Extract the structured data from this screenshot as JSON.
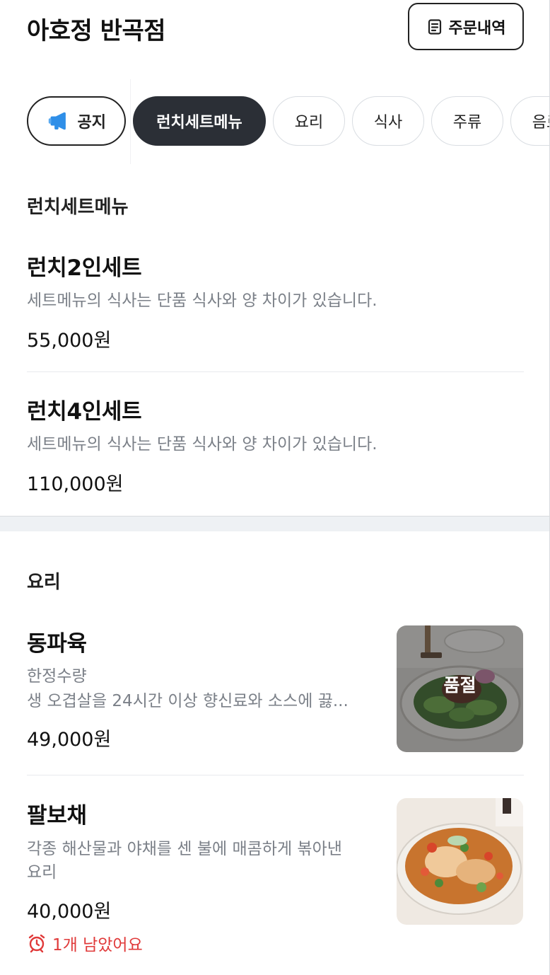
{
  "header": {
    "store_name": "아호정 반곡점",
    "orders_button": {
      "label": "주문내역",
      "icon": "receipt-icon"
    }
  },
  "tabs": [
    {
      "label": "공지",
      "icon": "megaphone-icon",
      "state": "outlined"
    },
    {
      "label": "런치세트메뉴",
      "state": "selected"
    },
    {
      "label": "요리",
      "state": "default"
    },
    {
      "label": "식사",
      "state": "default"
    },
    {
      "label": "주류",
      "state": "default"
    },
    {
      "label": "음료",
      "state": "partially-visible"
    }
  ],
  "sections": [
    {
      "title": "런치세트메뉴",
      "items": [
        {
          "name": "런치2인세트",
          "description": "세트메뉴의 식사는 단품 식사와 양 차이가 있습니다.",
          "price": "55,000원"
        },
        {
          "name": "런치4인세트",
          "description": "세트메뉴의 식사는 단품 식사와 양 차이가 있습니다.",
          "price": "110,000원"
        }
      ]
    },
    {
      "title": "요리",
      "items": [
        {
          "name": "동파육",
          "description_line1": "한정수량",
          "description_line2": "생 오겹살을 24시간 이상 향신료와 소스에 끓...",
          "price": "49,000원",
          "image_badge": "품절"
        },
        {
          "name": "팔보채",
          "description_line1": "각종 해산물과 야채를 센 불에 매콤하게 볶아낸",
          "description_line2": "요리",
          "price": "40,000원",
          "stock_warning": "1개 남았어요",
          "stock_warning_icon": "alarm-clock-icon"
        }
      ]
    }
  ],
  "colors": {
    "selected_tab_bg": "#2b2f36",
    "muted_text": "#7b8088",
    "warning_red": "#e03a3a",
    "notice_icon_blue": "#2f8fe8",
    "section_gap_bg": "#eef1f4"
  }
}
